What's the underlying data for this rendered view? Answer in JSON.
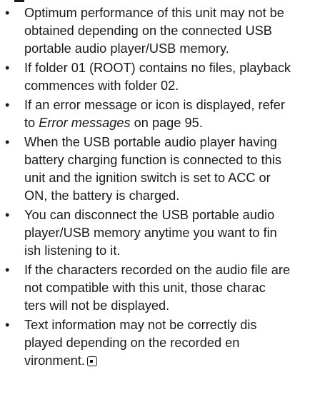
{
  "notes": [
    {
      "bullet": "•",
      "lines": [
        "Optimum performance of this unit may not be",
        "obtained depending on the connected USB",
        "portable audio player/USB memory."
      ]
    },
    {
      "bullet": "•",
      "lines": [
        "If folder 01 (ROOT) contains no files, playback",
        "commences with folder 02."
      ]
    },
    {
      "bullet": "•",
      "line1": "If an error message or icon is displayed, refer",
      "line2_prefix": "to ",
      "line2_link": "Error messages",
      "line2_suffix": " on page 95."
    },
    {
      "bullet": "•",
      "lines": [
        "When the USB portable audio player having",
        "battery charging function is connected to this",
        "unit and the ignition switch is set to ACC or",
        "ON, the battery is charged."
      ]
    },
    {
      "bullet": "•",
      "lines": [
        "You can disconnect the USB portable audio",
        "player/USB memory anytime you want to fin",
        "ish listening to it."
      ]
    },
    {
      "bullet": "•",
      "lines": [
        "If the characters recorded on the audio file are",
        "not compatible with this unit, those charac",
        "ters will not be displayed."
      ]
    },
    {
      "bullet": "•",
      "lines": [
        "Text information may not be correctly dis",
        "played depending on the recorded en",
        "vironment."
      ]
    }
  ]
}
